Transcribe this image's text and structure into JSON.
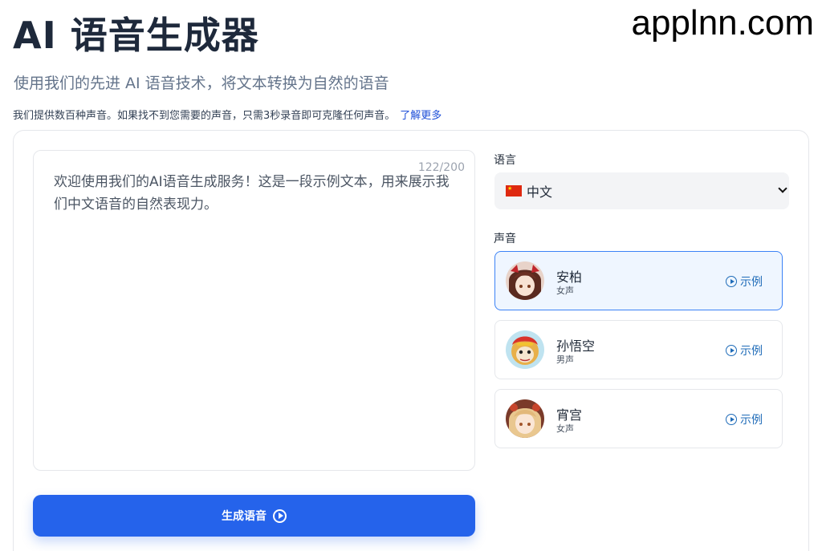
{
  "header": {
    "title": "AI 语音生成器",
    "watermark": "applnn.com",
    "subtitle": "使用我们的先进 AI 语音技术，将文本转换为自然的语音",
    "note": "我们提供数百种声音。如果找不到您需要的声音，只需3秒录音即可克隆任何声音。",
    "learn_more": "了解更多"
  },
  "editor": {
    "counter": "122/200",
    "text": "欢迎使用我们的AI语音生成服务！这是一段示例文本，用来展示我们中文语音的自然表现力。"
  },
  "generate_button": {
    "label": "生成语音"
  },
  "language": {
    "label": "语言",
    "selected": "中文",
    "flag_icon": "china-flag-icon"
  },
  "voices": {
    "label": "声音",
    "items": [
      {
        "name": "安柏",
        "type": "女声",
        "sample": "示例",
        "selected": true
      },
      {
        "name": "孙悟空",
        "type": "男声",
        "sample": "示例",
        "selected": false
      },
      {
        "name": "宵宫",
        "type": "女声",
        "sample": "示例",
        "selected": false
      }
    ]
  },
  "colors": {
    "primary": "#2563eb",
    "selected_bg": "#eff6ff",
    "selected_border": "#3b82f6",
    "link": "#1d4ed8"
  }
}
